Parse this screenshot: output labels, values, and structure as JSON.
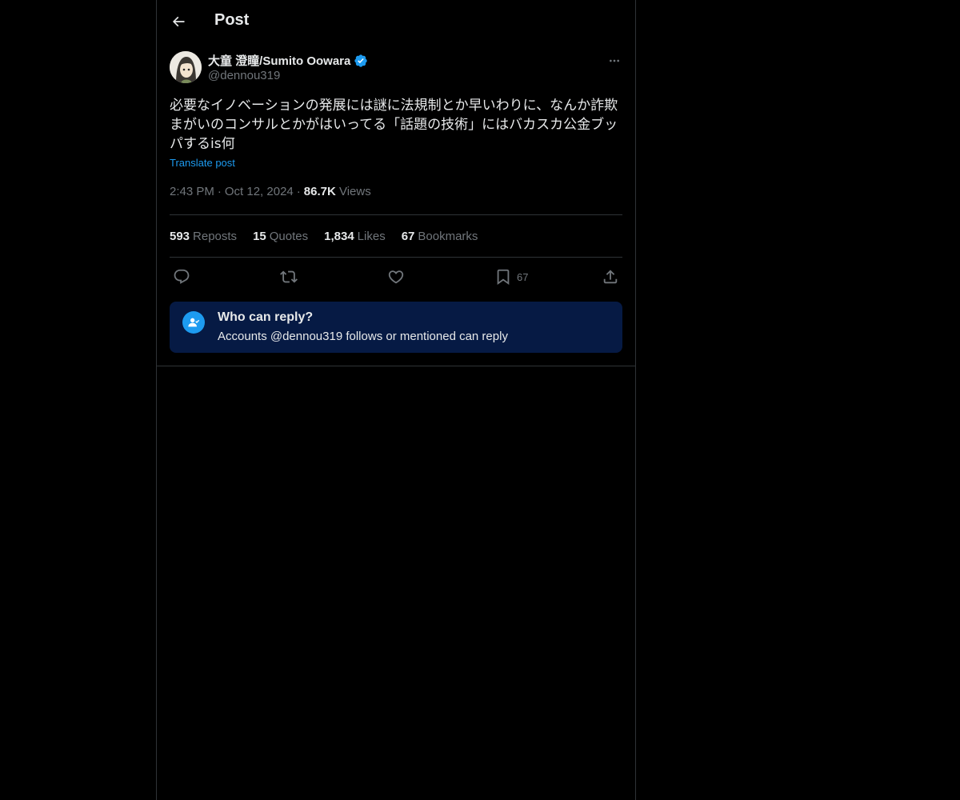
{
  "header": {
    "title": "Post"
  },
  "author": {
    "name": "大童 澄瞳/Sumito Oowara",
    "handle": "@dennou319",
    "verified": true
  },
  "post": {
    "text": "必要なイノベーションの発展には謎に法規制とか早いわりに、なんか詐欺まがいのコンサルとかがはいってる「話題の技術」にはバカスカ公金ブッパするis何",
    "translate_label": "Translate post",
    "time": "2:43 PM",
    "date": "Oct 12, 2024",
    "views_count": "86.7K",
    "views_label": "Views"
  },
  "stats": {
    "reposts": {
      "count": "593",
      "label": "Reposts"
    },
    "quotes": {
      "count": "15",
      "label": "Quotes"
    },
    "likes": {
      "count": "1,834",
      "label": "Likes"
    },
    "bookmarks": {
      "count": "67",
      "label": "Bookmarks"
    }
  },
  "actions": {
    "bookmark_count": "67",
    "icons": [
      "reply-icon",
      "repost-icon",
      "like-icon",
      "bookmark-icon",
      "share-icon"
    ]
  },
  "reply_restriction": {
    "title": "Who can reply?",
    "subtitle": "Accounts @dennou319 follows or mentioned can reply"
  },
  "colors": {
    "background": "#000000",
    "accent": "#1d9bf0",
    "muted": "#71767b",
    "border": "#2f3336",
    "reply_box_bg": "#061a44"
  }
}
